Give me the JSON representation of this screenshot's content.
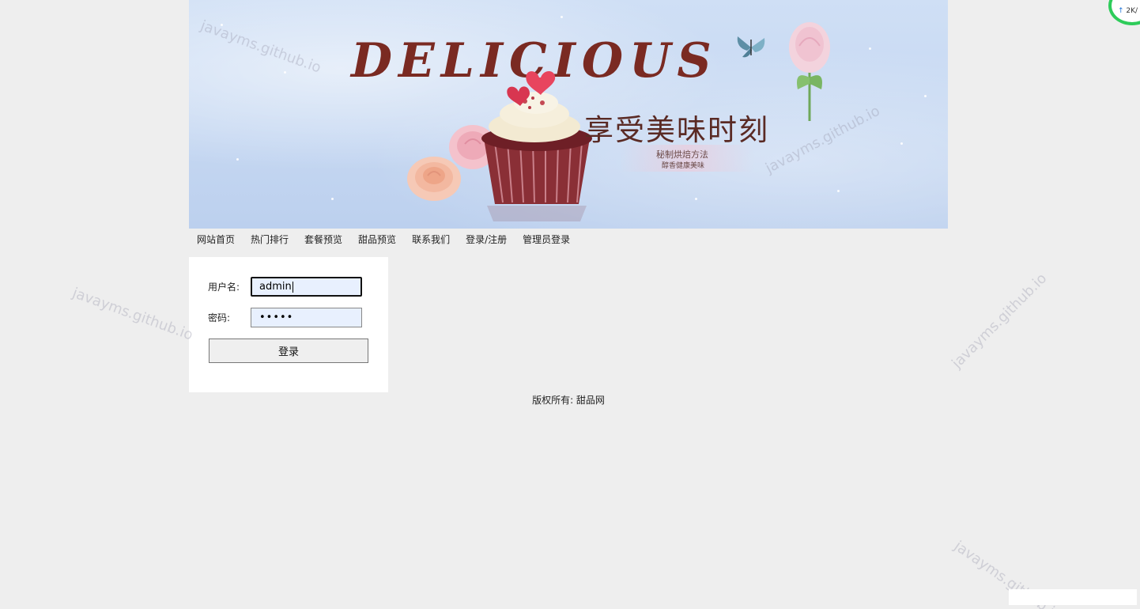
{
  "banner": {
    "title": "DELICIOUS",
    "slogan": "享受美味时刻",
    "sub_line1": "秘制烘焙方法",
    "sub_line2": "醇香健康美味"
  },
  "nav": {
    "items": [
      {
        "label": "网站首页"
      },
      {
        "label": "热门排行"
      },
      {
        "label": "套餐预览"
      },
      {
        "label": "甜品预览"
      },
      {
        "label": "联系我们"
      },
      {
        "label": "登录/注册"
      },
      {
        "label": "管理员登录"
      }
    ]
  },
  "login": {
    "username_label": "用户名:",
    "username_value": "admin",
    "password_label": "密码:",
    "password_mask": "•••••",
    "submit_label": "登录"
  },
  "footer": {
    "copyright": "版权所有: 甜品网"
  },
  "watermark": {
    "text": "javayms.github.io"
  },
  "speed_widget": {
    "upload_text": "2K/"
  },
  "colors": {
    "page_bg": "#eeeeee",
    "banner_title": "#7a2a22",
    "input_autofill_bg": "#e8f0fe",
    "widget_ring": "#2ecc5a"
  }
}
